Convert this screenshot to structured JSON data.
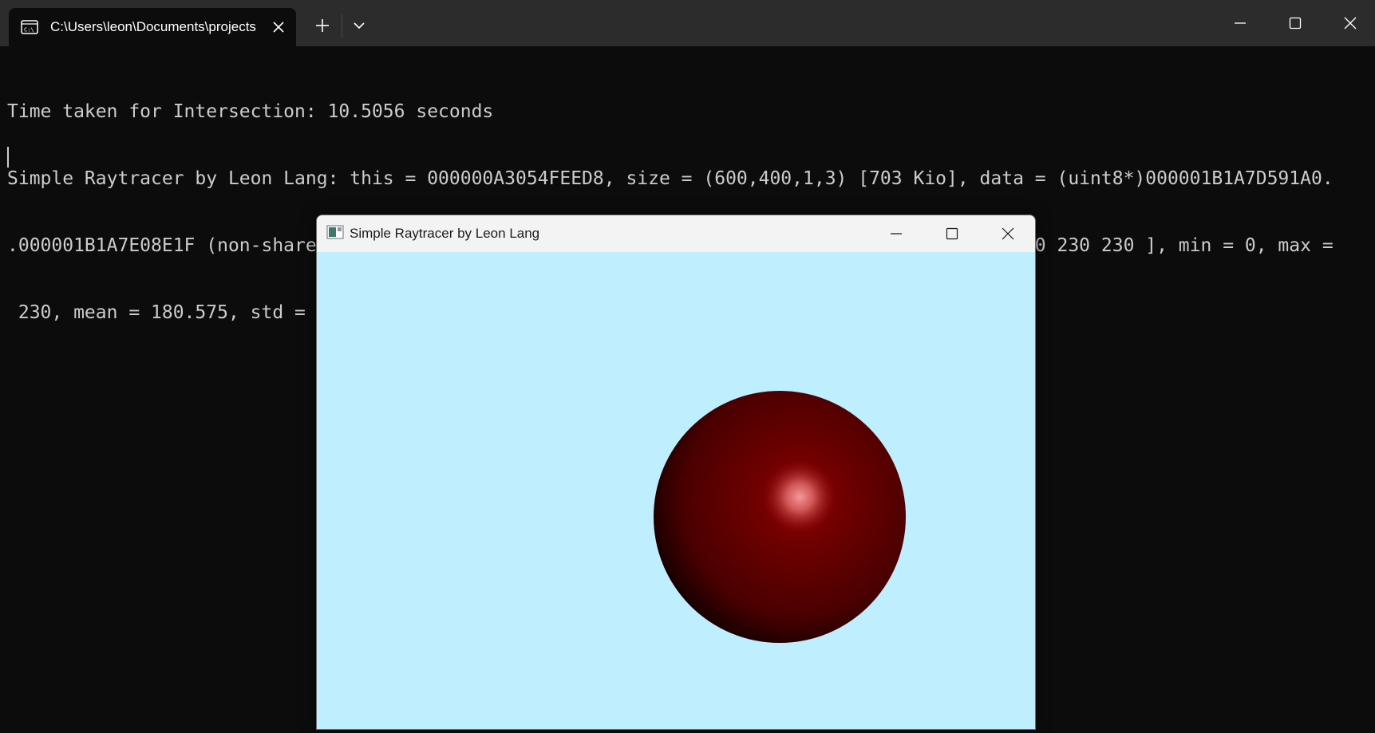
{
  "terminal_window": {
    "tab_title": "C:\\Users\\leon\\Documents\\projects",
    "new_tab_label": "+",
    "colors": {
      "background": "#0c0c0c",
      "titlebar": "#2c2c2c",
      "text": "#cccccc"
    },
    "icons": {
      "tab": "terminal-icon",
      "tab_close": "close-icon",
      "new_tab": "plus-icon",
      "dropdown": "chevron-down-icon",
      "minimize": "minimize-icon",
      "maximize": "maximize-icon",
      "close": "close-icon"
    }
  },
  "terminal_output": {
    "lines": [
      "Time taken for Intersection: 10.5056 seconds",
      "Simple Raytracer by Leon Lang: this = 000000A3054FEED8, size = (600,400,1,3) [703 Kio], data = (uint8*)000001B1A7D591A0.",
      ".000001B1A7E08E1F (non-shared) = [ 173 173 173 173 173 173 173 173 ... 230 230 230 230 230 230 230 230 ], min = 0, max =",
      " 230, mean = 180.575, std = 68.1751, coords_min = (367,118,0,1), coords_max = (0,0,0,2)."
    ]
  },
  "raytracer_window": {
    "title": "Simple Raytracer by Leon Lang",
    "colors": {
      "background": "#bfeefe",
      "sphere_base": "#6a0000",
      "sphere_dark": "#1a0000",
      "highlight": "#f49a9a"
    },
    "icons": {
      "app": "app-window-icon",
      "minimize": "minimize-icon",
      "maximize": "maximize-icon",
      "close": "close-icon"
    }
  }
}
